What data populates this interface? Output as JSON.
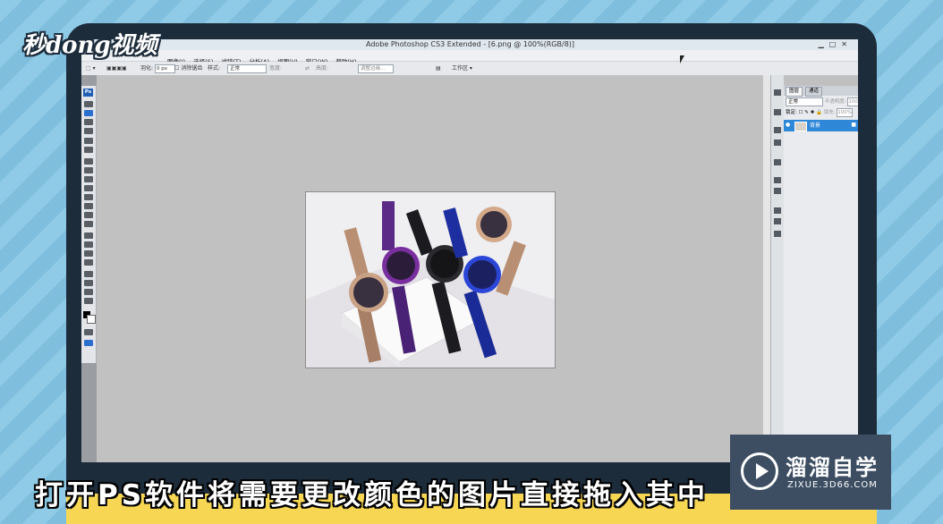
{
  "watermark": "秒dong视频",
  "window": {
    "title": "Adobe Photoshop CS3 Extended - [6.png @ 100%(RGB/8)]"
  },
  "menu": [
    "图像(I)",
    "选择(S)",
    "滤镜(T)",
    "分析(A)",
    "视图(V)",
    "窗口(W)",
    "帮助(H)"
  ],
  "options": {
    "feather_label": "羽化:",
    "feather_value": "0 px",
    "antialias_label": "消除锯齿",
    "style_label": "样式:",
    "style_value": "正常",
    "width_label": "宽度:",
    "height_label": "高度:",
    "refine_edge": "调整边缘...",
    "workspace": "工作区"
  },
  "toolbox": {
    "badge": "Ps"
  },
  "layers_panel": {
    "tabs": [
      "图层",
      "通道"
    ],
    "blend_mode": "正常",
    "opacity_label": "不透明度:",
    "opacity_value": "100%",
    "lock_label": "锁定:",
    "fill_label": "填充:",
    "fill_value": "100%",
    "layer_name": "背景"
  },
  "subtitle": "打开PS软件将需要更改颜色的图片直接拖入其中",
  "logo": {
    "name": "溜溜自学",
    "url": "ZIXUE.3D66.COM"
  },
  "colors": {
    "bezel": "#1d2c3b",
    "subtitle_bar": "#f6d653",
    "layer_selected": "#2f87d8",
    "logo_bg": "#3d4e63"
  }
}
